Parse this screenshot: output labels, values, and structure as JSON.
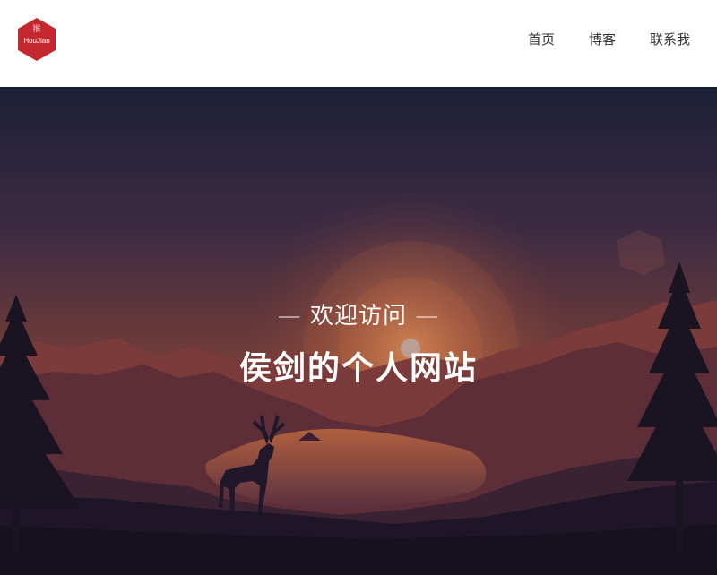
{
  "logo": {
    "mark": "猴",
    "text": "HouJian",
    "color": "#c3282e"
  },
  "nav": {
    "links": [
      {
        "label": "首页"
      },
      {
        "label": "博客"
      },
      {
        "label": "联系我"
      }
    ]
  },
  "hero": {
    "subtitle": "— 欢迎访问 —",
    "title": "侯剑的个人网站",
    "background": "sunset-forest-landscape-with-deer"
  }
}
